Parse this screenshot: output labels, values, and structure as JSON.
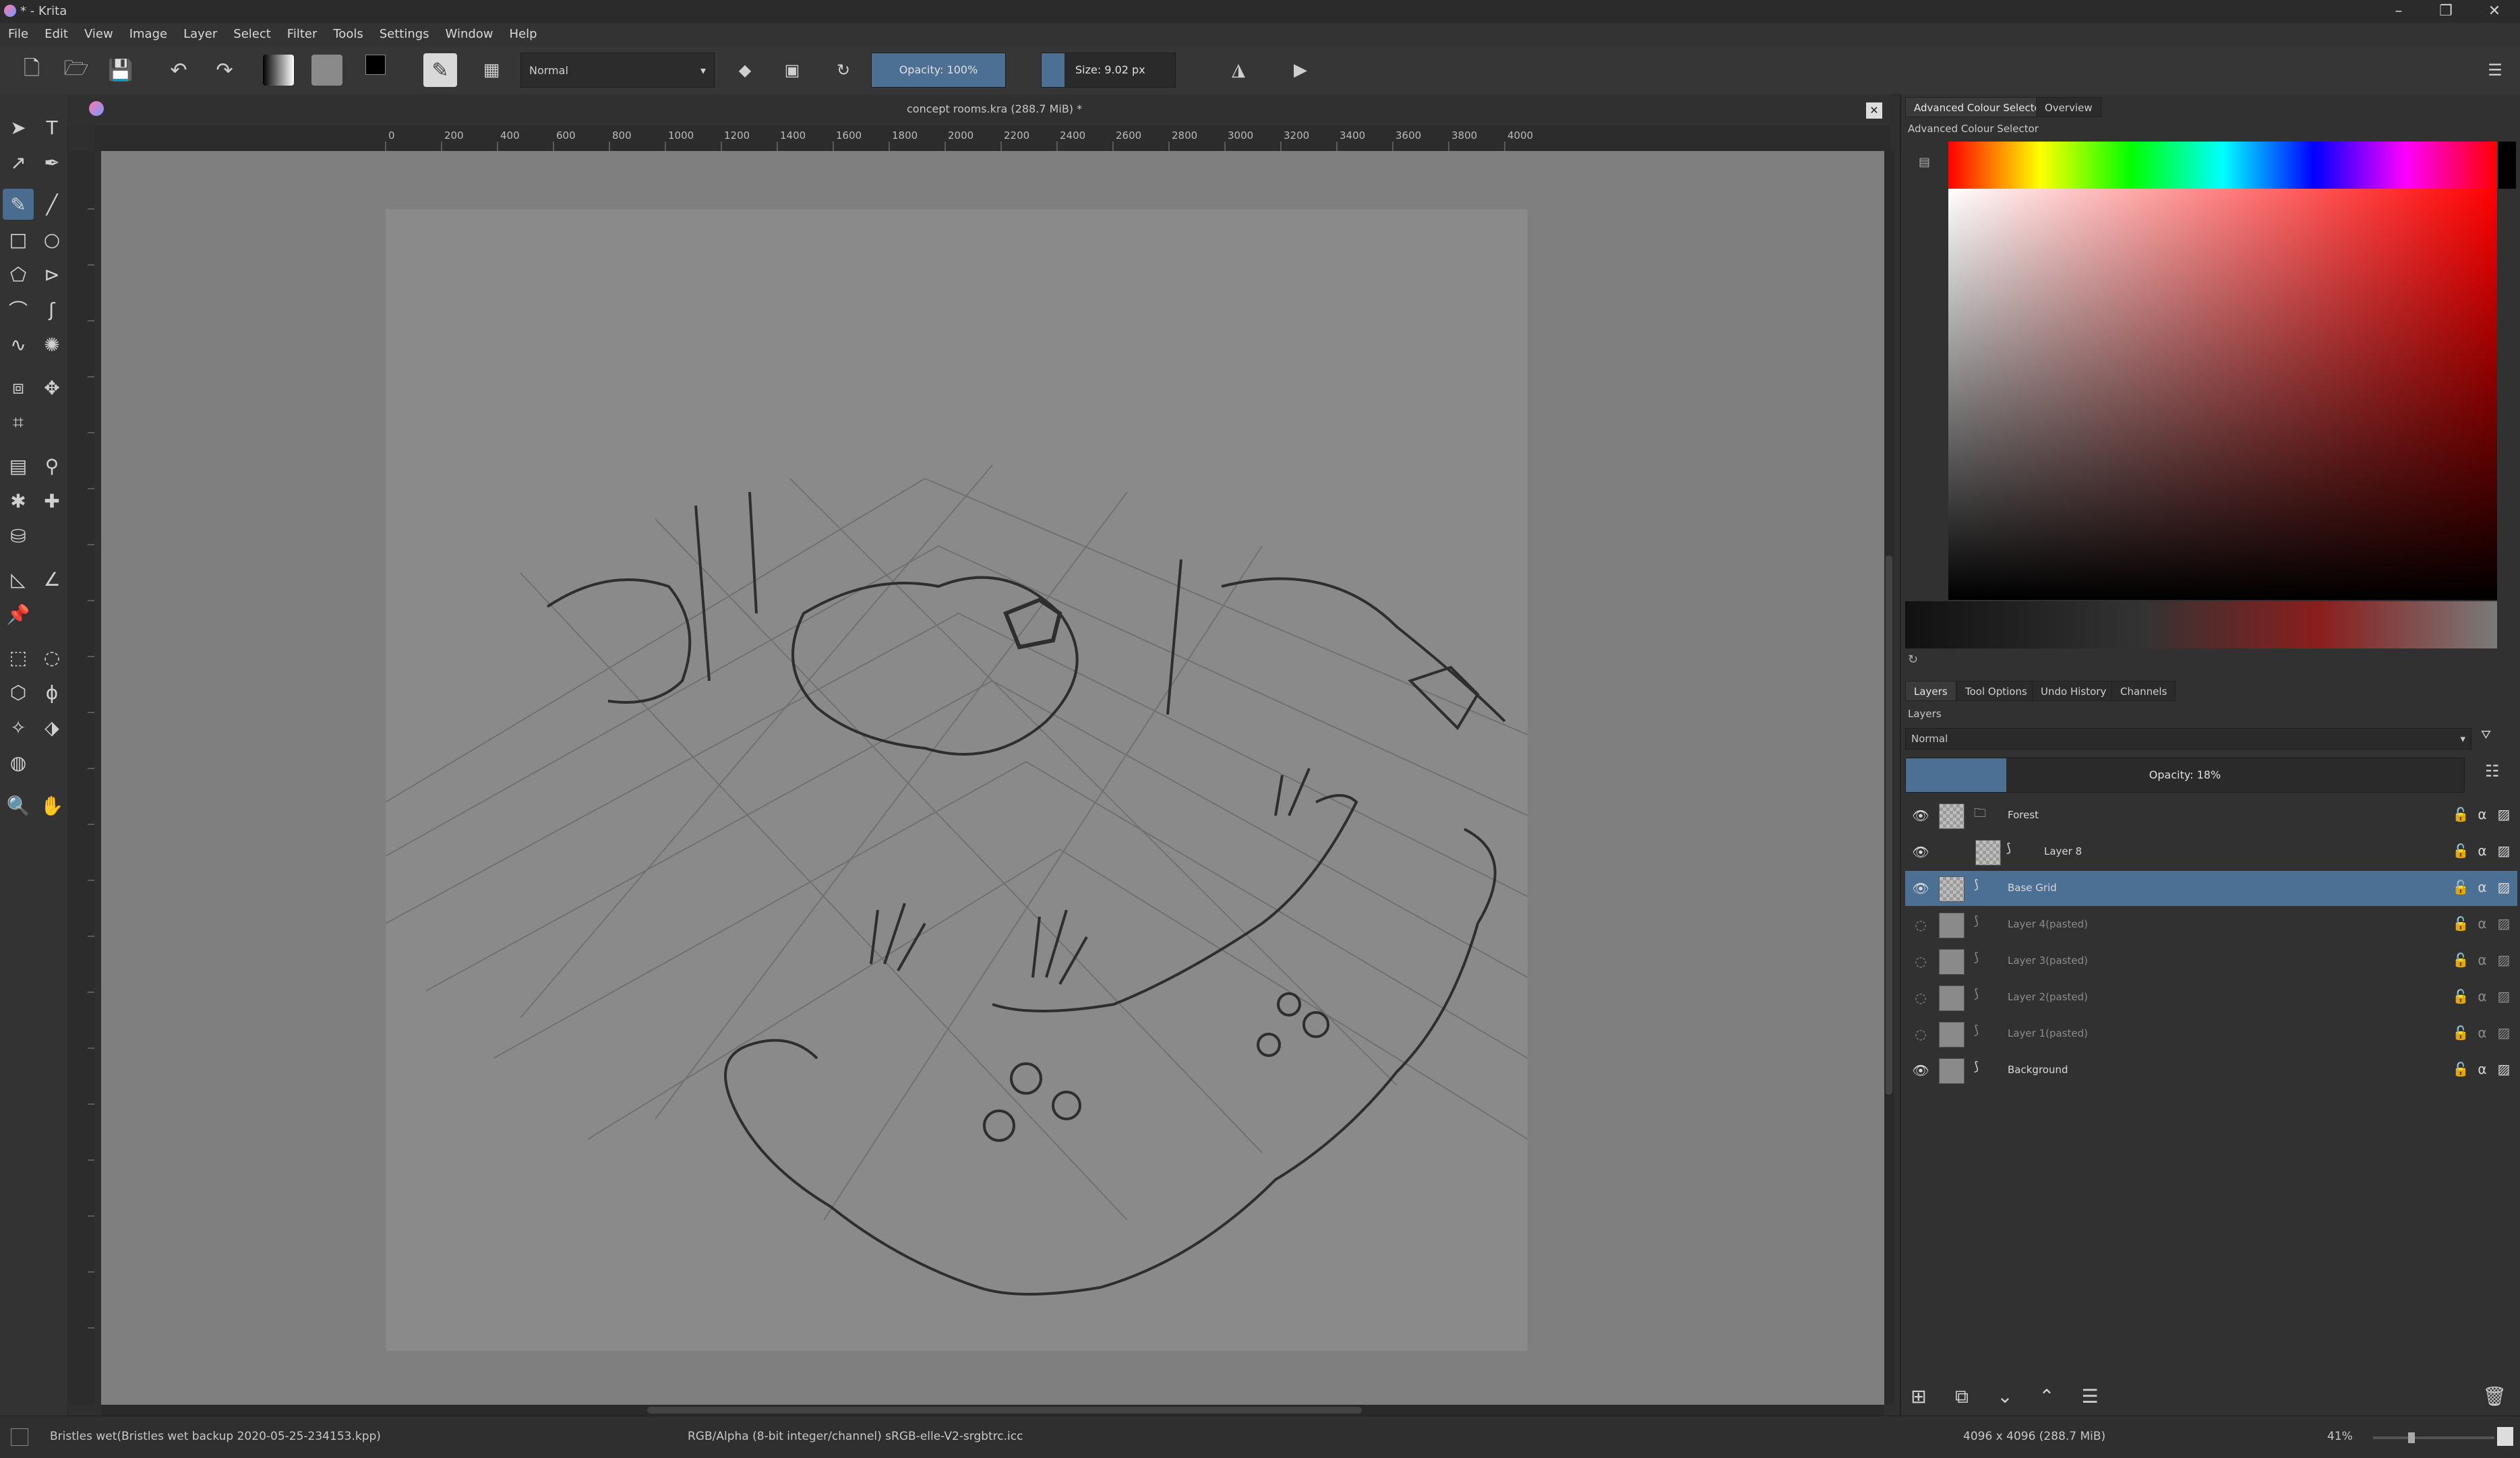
{
  "window": {
    "title": "* - Krita"
  },
  "menubar": {
    "items": [
      "File",
      "Edit",
      "View",
      "Image",
      "Layer",
      "Select",
      "Filter",
      "Tools",
      "Settings",
      "Window",
      "Help"
    ]
  },
  "toolbar": {
    "blend_mode": "Normal",
    "opacity_label": "Opacity: 100%",
    "opacity_value": 1.0,
    "size_label": "Size: 9.02 px"
  },
  "document": {
    "title": "concept rooms.kra (288.7 MiB) *",
    "ruler_marks": [
      "0",
      "200",
      "400",
      "600",
      "800",
      "1000",
      "1200",
      "1400",
      "1600",
      "1800",
      "2000",
      "2200",
      "2400",
      "2600",
      "2800",
      "3000",
      "3200",
      "3400",
      "3600",
      "3800",
      "4000"
    ]
  },
  "colour_docker": {
    "tabs": [
      "Advanced Colour Selector",
      "Overview"
    ],
    "title": "Advanced Colour Selector"
  },
  "layers_docker": {
    "tabs": [
      "Layers",
      "Tool Options",
      "Undo History",
      "Channels"
    ],
    "title": "Layers",
    "blend_mode": "Normal",
    "opacity_label": "Opacity: 18%",
    "opacity_value": 0.18,
    "layers": [
      {
        "name": "Forest",
        "visible": true,
        "selected": false,
        "type": "group"
      },
      {
        "name": "Layer 8",
        "visible": true,
        "selected": false,
        "type": "paint"
      },
      {
        "name": "Base Grid",
        "visible": true,
        "selected": true,
        "type": "paint"
      },
      {
        "name": "Layer 4(pasted)",
        "visible": false,
        "selected": false,
        "type": "paint"
      },
      {
        "name": "Layer 3(pasted)",
        "visible": false,
        "selected": false,
        "type": "paint"
      },
      {
        "name": "Layer 2(pasted)",
        "visible": false,
        "selected": false,
        "type": "paint"
      },
      {
        "name": "Layer 1(pasted)",
        "visible": false,
        "selected": false,
        "type": "paint"
      },
      {
        "name": "Background",
        "visible": true,
        "selected": false,
        "type": "paint"
      }
    ]
  },
  "statusbar": {
    "brush": "Bristles wet(Bristles wet backup 2020-05-25-234153.kpp)",
    "color_profile": "RGB/Alpha (8-bit integer/channel)  sRGB-elle-V2-srgbtrc.icc",
    "image_size": "4096 x 4096 (288.7 MiB)",
    "zoom": "41%"
  },
  "colors": {
    "accent": "#4c6f94",
    "canvas": "#7f7f7f",
    "panel": "#313131"
  }
}
